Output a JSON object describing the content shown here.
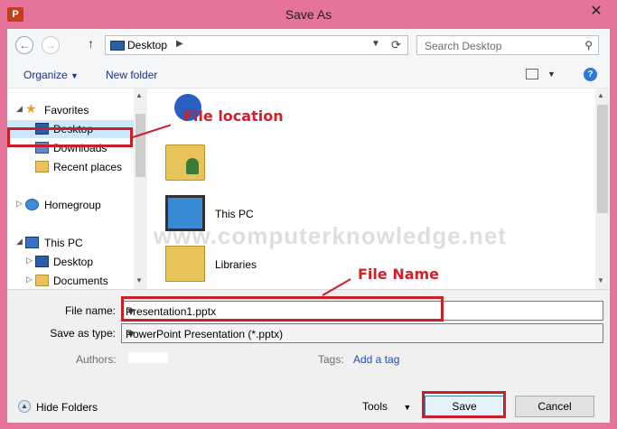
{
  "window": {
    "title": "Save As",
    "app_icon": "P",
    "close": "✕"
  },
  "nav": {
    "back": "←",
    "forward": "→",
    "up": "↑",
    "address": "Desktop",
    "search_placeholder": "Search Desktop"
  },
  "toolbar": {
    "organize": "Organize",
    "new_folder": "New folder",
    "help": "?"
  },
  "navpane": {
    "items": [
      {
        "label": "Favorites",
        "icon": "star-icon"
      },
      {
        "label": "Desktop",
        "icon": "desktop-icon"
      },
      {
        "label": "Downloads",
        "icon": "downloads-icon"
      },
      {
        "label": "Recent places",
        "icon": "recent-places-icon"
      },
      {
        "label": "Homegroup",
        "icon": "homegroup-icon"
      },
      {
        "label": "This PC",
        "icon": "pc-icon"
      },
      {
        "label": "Desktop",
        "icon": "desktop-icon"
      },
      {
        "label": "Documents",
        "icon": "documents-icon"
      }
    ]
  },
  "files": {
    "items": [
      {
        "label": "",
        "icon": "network-icon"
      },
      {
        "label": "",
        "icon": "user-folder-icon"
      },
      {
        "label": "This PC",
        "icon": "pc-icon"
      },
      {
        "label": "Libraries",
        "icon": "libraries-icon"
      }
    ]
  },
  "watermark": "www.computerknowledge.net",
  "form": {
    "file_name_label": "File name:",
    "file_name_value": "Presentation1.pptx",
    "save_as_type_label": "Save as type:",
    "save_as_type_value": "PowerPoint Presentation (*.pptx)",
    "authors_label": "Authors:",
    "tags_label": "Tags:",
    "add_tag": "Add a tag"
  },
  "footer": {
    "hide_folders": "Hide Folders",
    "tools": "Tools",
    "save": "Save",
    "cancel": "Cancel"
  },
  "annotations": {
    "file_location": "File location",
    "file_name": "File Name"
  },
  "colors": {
    "frame": "#e6739a",
    "annotation": "#d0202a",
    "link": "#1e4fb8"
  }
}
